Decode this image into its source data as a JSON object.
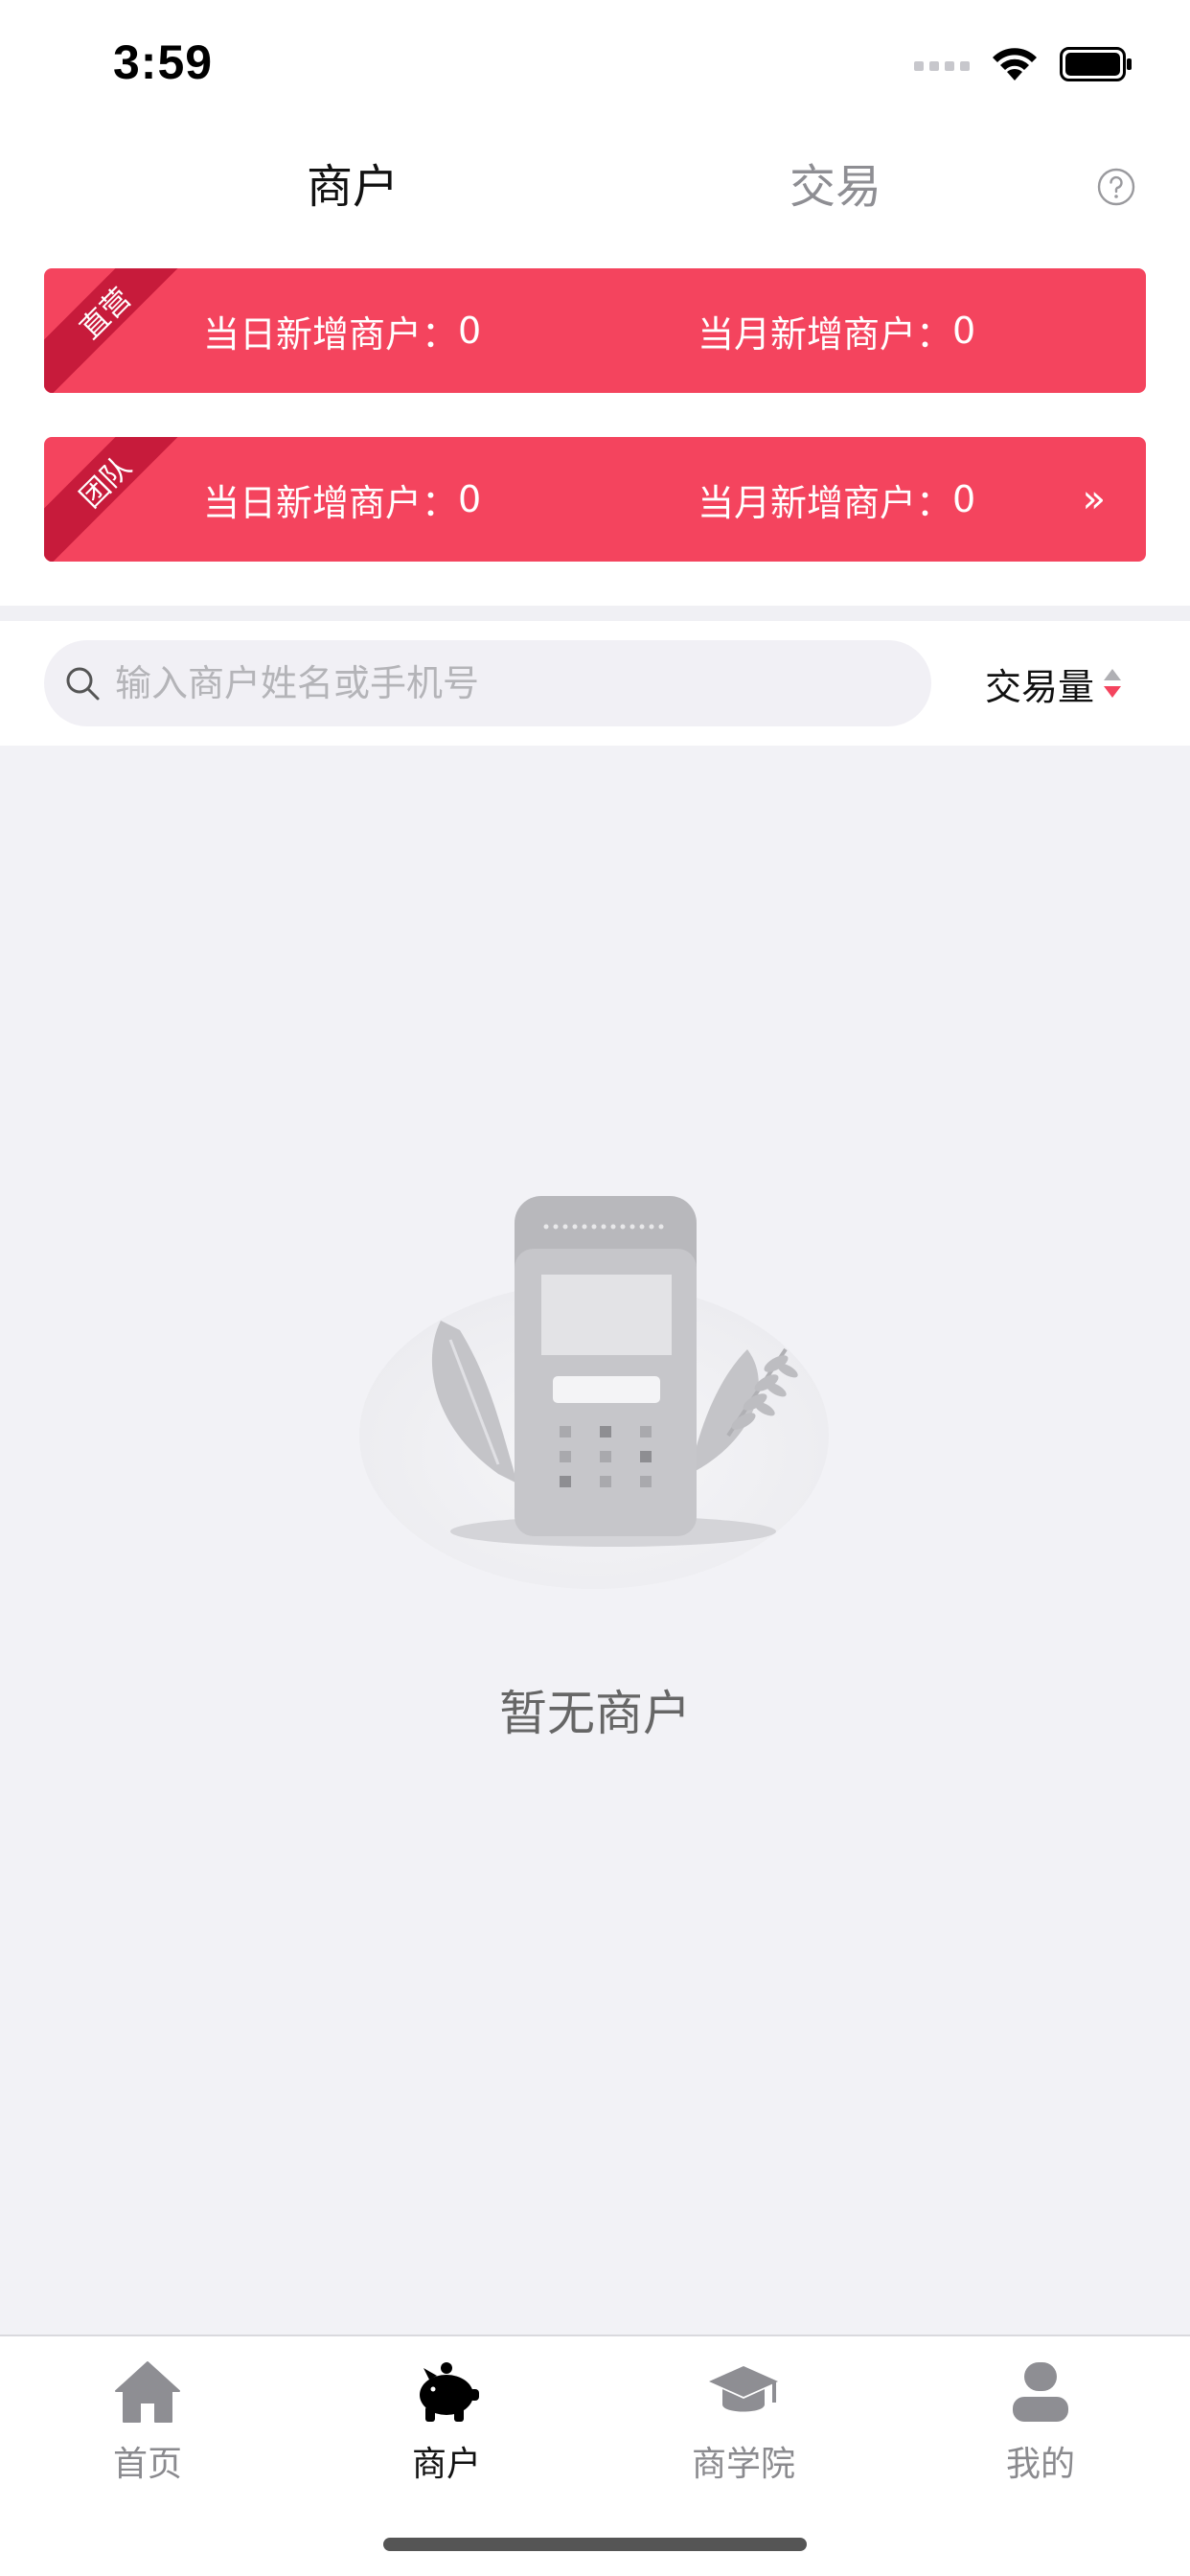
{
  "status_bar": {
    "time": "3:59"
  },
  "tabs": {
    "merchant": "商户",
    "transaction": "交易"
  },
  "cards": [
    {
      "tag": "直营",
      "daily_label": "当日新增商户：",
      "daily_value": "0",
      "monthly_label": "当月新增商户：",
      "monthly_value": "0"
    },
    {
      "tag": "团队",
      "daily_label": "当日新增商户：",
      "daily_value": "0",
      "monthly_label": "当月新增商户：",
      "monthly_value": "0",
      "arrow": "»"
    }
  ],
  "search": {
    "placeholder": "输入商户姓名或手机号",
    "value": ""
  },
  "sort": {
    "label": "交易量"
  },
  "empty_state": {
    "text": "暂无商户"
  },
  "bottom_nav": [
    {
      "label": "首页",
      "icon": "home-icon"
    },
    {
      "label": "商户",
      "icon": "piggy-bank-icon",
      "active": true
    },
    {
      "label": "商学院",
      "icon": "graduation-cap-icon"
    },
    {
      "label": "我的",
      "icon": "user-icon"
    }
  ],
  "colors": {
    "card_red": "#f4445e",
    "ribbon_dark_red": "#c71b3b",
    "sort_down_red": "#f4445e",
    "background": "#f2f2f6"
  }
}
